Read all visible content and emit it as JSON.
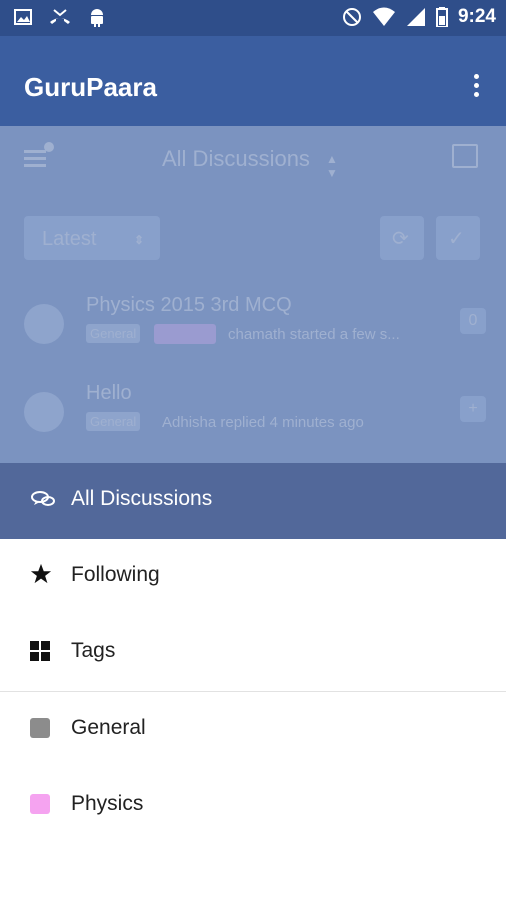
{
  "status_bar": {
    "time": "9:24"
  },
  "app_bar": {
    "title": "GuruPaara",
    "overflow_icon": "more-vertical-icon"
  },
  "background": {
    "header_title": "All Discussions",
    "sort_label": "Latest",
    "discussions": [
      {
        "title": "Physics 2015 3rd MCQ",
        "tags": [
          "General",
          ""
        ],
        "meta": "chamath started a few s...",
        "count": "0"
      },
      {
        "title": "Hello",
        "tags": [
          "General"
        ],
        "meta": "Adhisha replied 4 minutes ago",
        "count": "+"
      }
    ]
  },
  "drawer": {
    "items": [
      {
        "label": "All Discussions",
        "icon": "discussions-icon",
        "selected": true
      },
      {
        "label": "Following",
        "icon": "star-icon"
      },
      {
        "label": "Tags",
        "icon": "grid-icon"
      }
    ],
    "tags": [
      {
        "label": "General",
        "color": "#8c8c8c"
      },
      {
        "label": "Physics",
        "color": "#f5a3f0"
      }
    ]
  }
}
